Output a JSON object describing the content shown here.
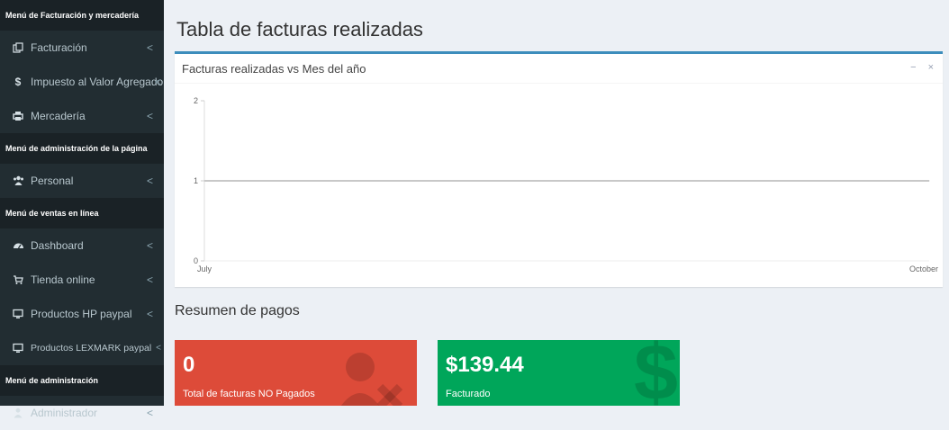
{
  "sidebar": {
    "header1": "Menú de Facturación y mercadería",
    "items1": [
      {
        "label": "Facturación",
        "icon": "copy-icon"
      },
      {
        "label": "Impuesto al Valor Agregado",
        "icon": "dollar-icon"
      },
      {
        "label": "Mercadería",
        "icon": "print-icon"
      }
    ],
    "header2": "Menú de administración de la página",
    "items2": [
      {
        "label": "Personal",
        "icon": "users-icon"
      }
    ],
    "header3": "Menú de ventas en línea",
    "items3": [
      {
        "label": "Dashboard",
        "icon": "dashboard-icon"
      },
      {
        "label": "Tienda online",
        "icon": "cart-icon"
      },
      {
        "label": "Productos HP paypal",
        "icon": "desktop-icon"
      },
      {
        "label": "Productos LEXMARK paypal",
        "icon": "desktop-icon"
      }
    ],
    "header4": "Menú de administración",
    "items4": [
      {
        "label": "Administrador",
        "icon": "user-icon"
      }
    ],
    "chevron": "<"
  },
  "main": {
    "title": "Tabla de facturas realizadas",
    "box": {
      "title": "Facturas realizadas vs Mes del año",
      "minimize": "−",
      "close": "×"
    },
    "summary_title": "Resumen de pagos",
    "cards": [
      {
        "value": "0",
        "label": "Total de facturas NO Pagados",
        "color": "#dd4b39",
        "icon": "user-times-icon"
      },
      {
        "value": "$139.44",
        "label": "Facturado",
        "color": "#00a65a",
        "icon": "dollar-icon"
      }
    ]
  },
  "chart_data": {
    "type": "line",
    "categories": [
      "July",
      "October"
    ],
    "series": [
      {
        "values": [
          1,
          1
        ]
      }
    ],
    "ylim": [
      0,
      2
    ],
    "yticks": [
      "0",
      "1",
      "2"
    ],
    "grid": false
  }
}
